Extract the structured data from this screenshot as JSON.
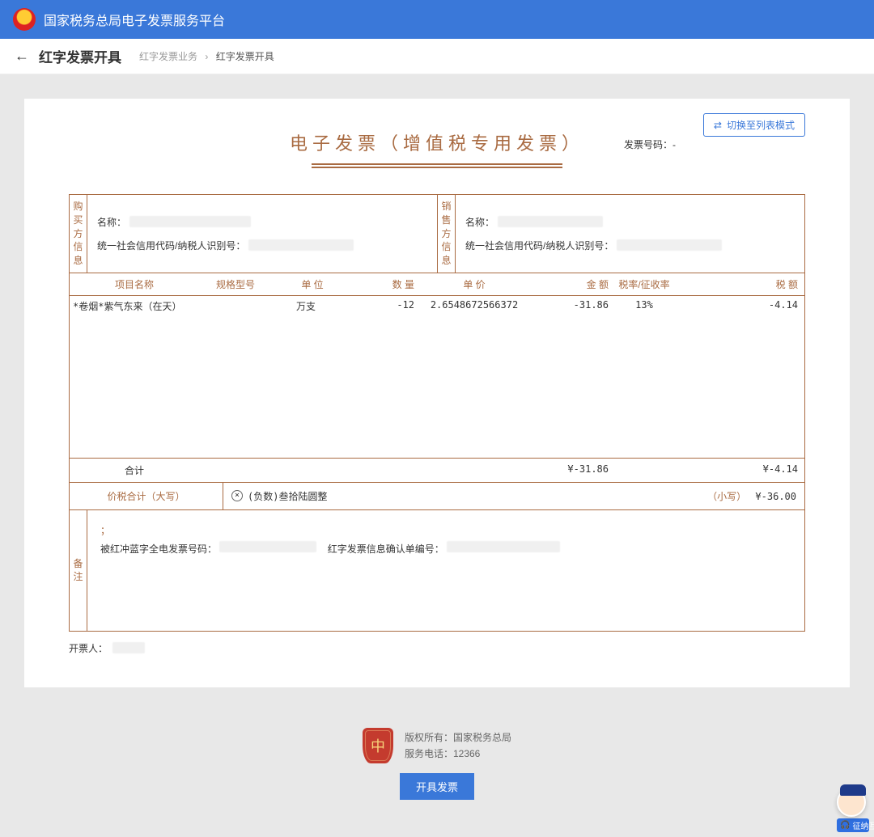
{
  "header": {
    "platform_title": "国家税务总局电子发票服务平台"
  },
  "breadcrumb": {
    "page_name": "红字发票开具",
    "trail_business": "红字发票业务",
    "trail_current": "红字发票开具"
  },
  "actions": {
    "switch_mode_label": "切换至列表模式",
    "issue_button_label": "开具发票"
  },
  "invoice": {
    "number_label": "发票号码：",
    "number_value": "-",
    "title": "电子发票（增值税专用发票）",
    "buyer_section_label": "购买方信息",
    "seller_section_label": "销售方信息",
    "name_label": "名称：",
    "taxid_label": "统一社会信用代码/纳税人识别号：",
    "columns": {
      "item": "项目名称",
      "spec": "规格型号",
      "unit": "单 位",
      "qty": "数 量",
      "price": "单 价",
      "amount": "金 额",
      "rate": "税率/征收率",
      "tax": "税 额"
    },
    "items": [
      {
        "name": "*卷烟*紫气东来（在天）",
        "spec": "",
        "unit": "万支",
        "qty": "-12",
        "price": "2.6548672566372",
        "amount": "-31.86",
        "rate": "13%",
        "tax": "-4.14"
      }
    ],
    "total": {
      "label": "合计",
      "amount": "¥-31.86",
      "tax": "¥-4.14"
    },
    "grand": {
      "label": "价税合计（大写）",
      "big_words": "(负数)叁拾陆圆整",
      "small_label": "（小写）",
      "small_value": "¥-36.00"
    },
    "remark": {
      "section_label": "备注",
      "line1_before": "；",
      "blue_ref_label": "被红冲蓝字全电发票号码：",
      "confirm_no_label": "红字发票信息确认单编号："
    },
    "issuer_label": "开票人："
  },
  "footer": {
    "copyright": "版权所有：国家税务总局",
    "hotline": "服务电话：12366"
  },
  "assistant": {
    "badge": "征纳互"
  }
}
